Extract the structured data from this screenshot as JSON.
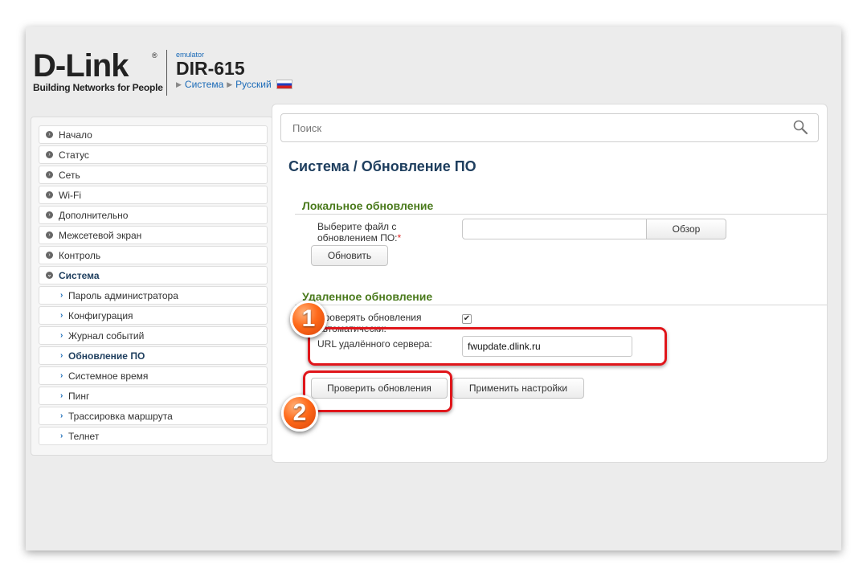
{
  "brand": {
    "logo": "D-Link",
    "registered": "®",
    "tagline": "Building Networks for People"
  },
  "device": {
    "emulator_label": "emulator",
    "model": "DIR-615",
    "breadcrumb": [
      "Система",
      "Русский"
    ]
  },
  "search": {
    "placeholder": "Поиск"
  },
  "sidebar": {
    "items": [
      {
        "label": "Начало"
      },
      {
        "label": "Статус"
      },
      {
        "label": "Сеть"
      },
      {
        "label": "Wi-Fi"
      },
      {
        "label": "Дополнительно"
      },
      {
        "label": "Межсетевой экран"
      },
      {
        "label": "Контроль"
      },
      {
        "label": "Система"
      }
    ],
    "sub_items": [
      {
        "label": "Пароль администратора"
      },
      {
        "label": "Конфигурация"
      },
      {
        "label": "Журнал событий"
      },
      {
        "label": "Обновление ПО"
      },
      {
        "label": "Системное время"
      },
      {
        "label": "Пинг"
      },
      {
        "label": "Трассировка маршрута"
      },
      {
        "label": "Телнет"
      }
    ]
  },
  "page": {
    "title": "Система /  Обновление ПО"
  },
  "local_update": {
    "title": "Локальное обновление",
    "file_label_line1": "Выберите файл с",
    "file_label_line2": "обновлением ПО:",
    "required_mark": "*",
    "browse_button": "Обзор",
    "update_button": "Обновить"
  },
  "remote_update": {
    "title": "Удаленное обновление",
    "auto_check_label_line1": "Проверять обновления",
    "auto_check_label_line2": "автоматически:",
    "auto_check_checked": true,
    "checkmark": "✔",
    "url_label": "URL удалённого сервера:",
    "url_value": "fwupdate.dlink.ru",
    "check_button": "Проверить обновления",
    "apply_button": "Применить настройки"
  },
  "annotations": {
    "badge1": "1",
    "badge2": "2",
    "highlight_color": "#e0161b",
    "badge_color": "#ff6a1a"
  },
  "colors": {
    "title": "#1e3e5e",
    "section": "#4a7a1c",
    "link": "#1a6ab7"
  }
}
